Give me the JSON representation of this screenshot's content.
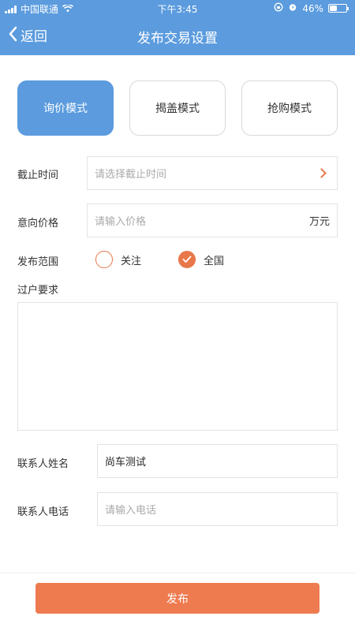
{
  "status_bar": {
    "carrier": "中国联通",
    "time": "下午3:45",
    "battery": "46%",
    "battery_level": 0.46
  },
  "nav": {
    "back_label": "返回",
    "title": "发布交易设置"
  },
  "modes": [
    {
      "label": "询价模式",
      "active": true
    },
    {
      "label": "揭盖模式",
      "active": false
    },
    {
      "label": "抢购模式",
      "active": false
    }
  ],
  "form": {
    "deadline": {
      "label": "截止时间",
      "placeholder": "请选择截止时间"
    },
    "price": {
      "label": "意向价格",
      "placeholder": "请输入价格",
      "unit": "万元"
    },
    "scope": {
      "label": "发布范围",
      "options": [
        {
          "label": "关注",
          "checked": false
        },
        {
          "label": "全国",
          "checked": true
        }
      ]
    },
    "transfer": {
      "label": "过户要求",
      "value": ""
    },
    "contact_name": {
      "label": "联系人姓名",
      "value": "尚车测试"
    },
    "contact_phone": {
      "label": "联系人电话",
      "placeholder": "请输入电话"
    }
  },
  "submit_label": "发布",
  "colors": {
    "primary_blue": "#5b9bde",
    "accent_orange": "#ee7b50"
  }
}
